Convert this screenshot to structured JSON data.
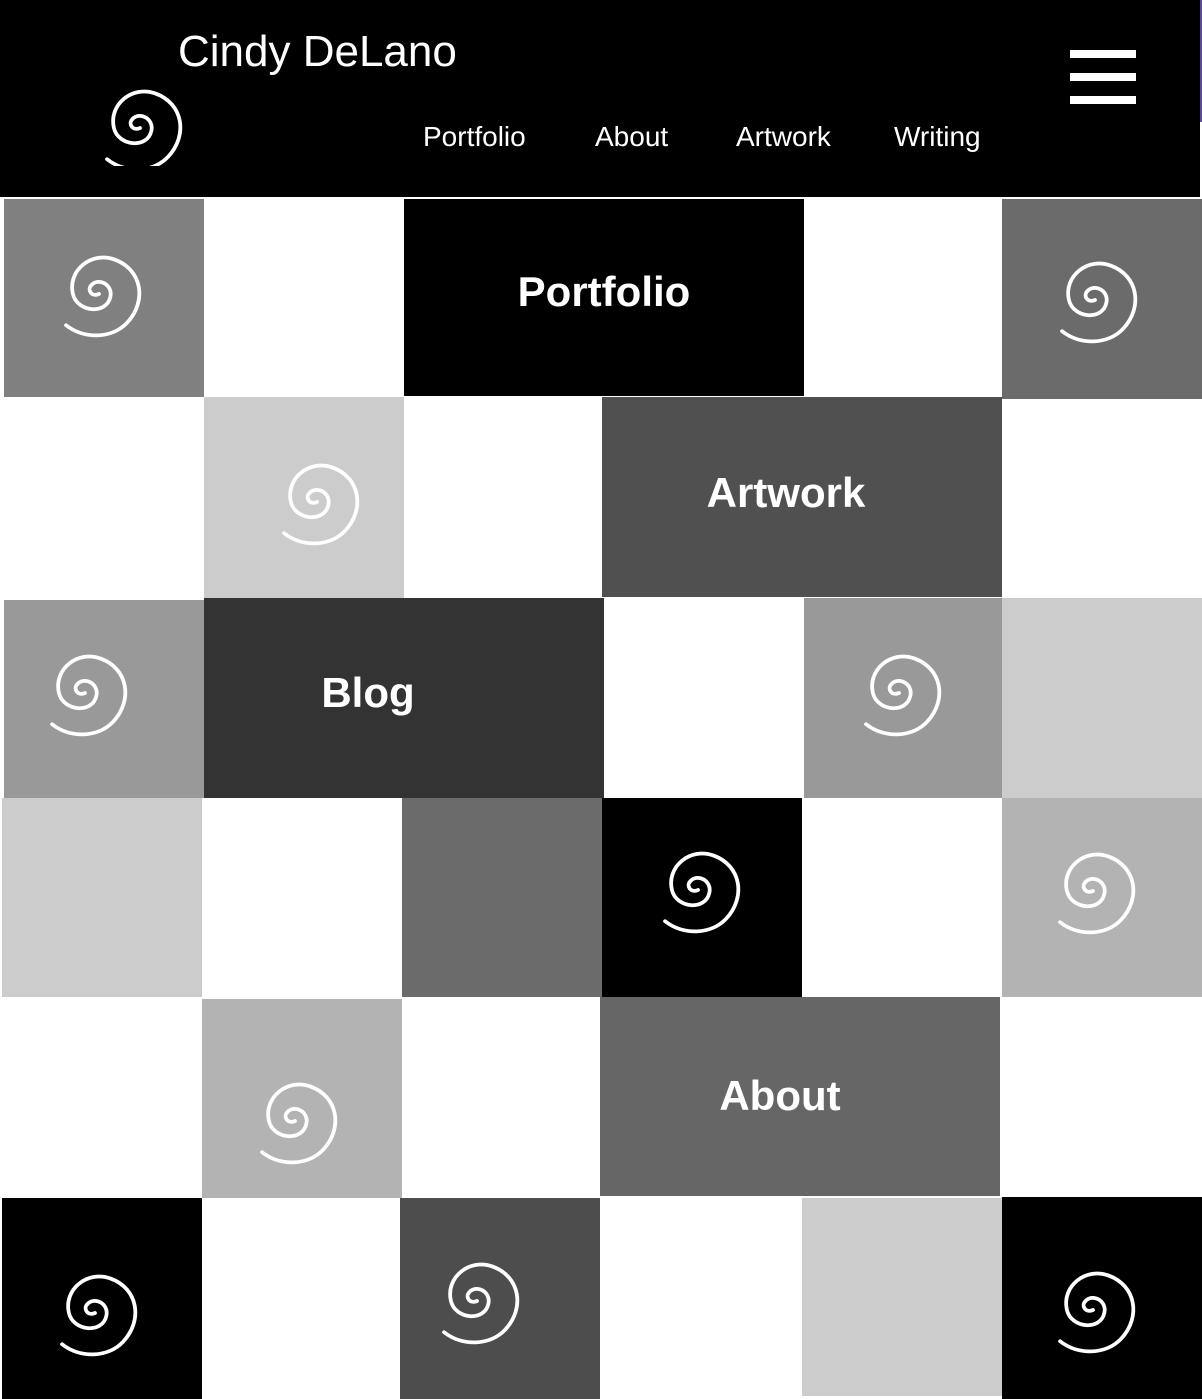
{
  "header": {
    "site_title": "Cindy DeLano",
    "logo_icon": "spiral-icon",
    "menu_icon": "hamburger-menu-icon",
    "background": "#000000",
    "text_color": "#ffffff"
  },
  "nav": {
    "items": [
      {
        "label": "Portfolio"
      },
      {
        "label": "About"
      },
      {
        "label": "Artwork"
      },
      {
        "label": "Writing"
      }
    ]
  },
  "grid": {
    "tile_icon": "spiral-icon",
    "feature_tiles": [
      {
        "label": "Portfolio",
        "color": "#000000"
      },
      {
        "label": "Artwork",
        "color": "#505050"
      },
      {
        "label": "Blog",
        "color": "#333333"
      },
      {
        "label": "About",
        "color": "#666666"
      }
    ],
    "palette": {
      "white": "#ffffff",
      "light_gray": "#cccccc",
      "silver": "#b3b3b3",
      "mid_gray": "#999999",
      "gray": "#808080",
      "dim_gray": "#6b6b6b",
      "dark_gray": "#4d4d4d",
      "black": "#000000"
    }
  }
}
